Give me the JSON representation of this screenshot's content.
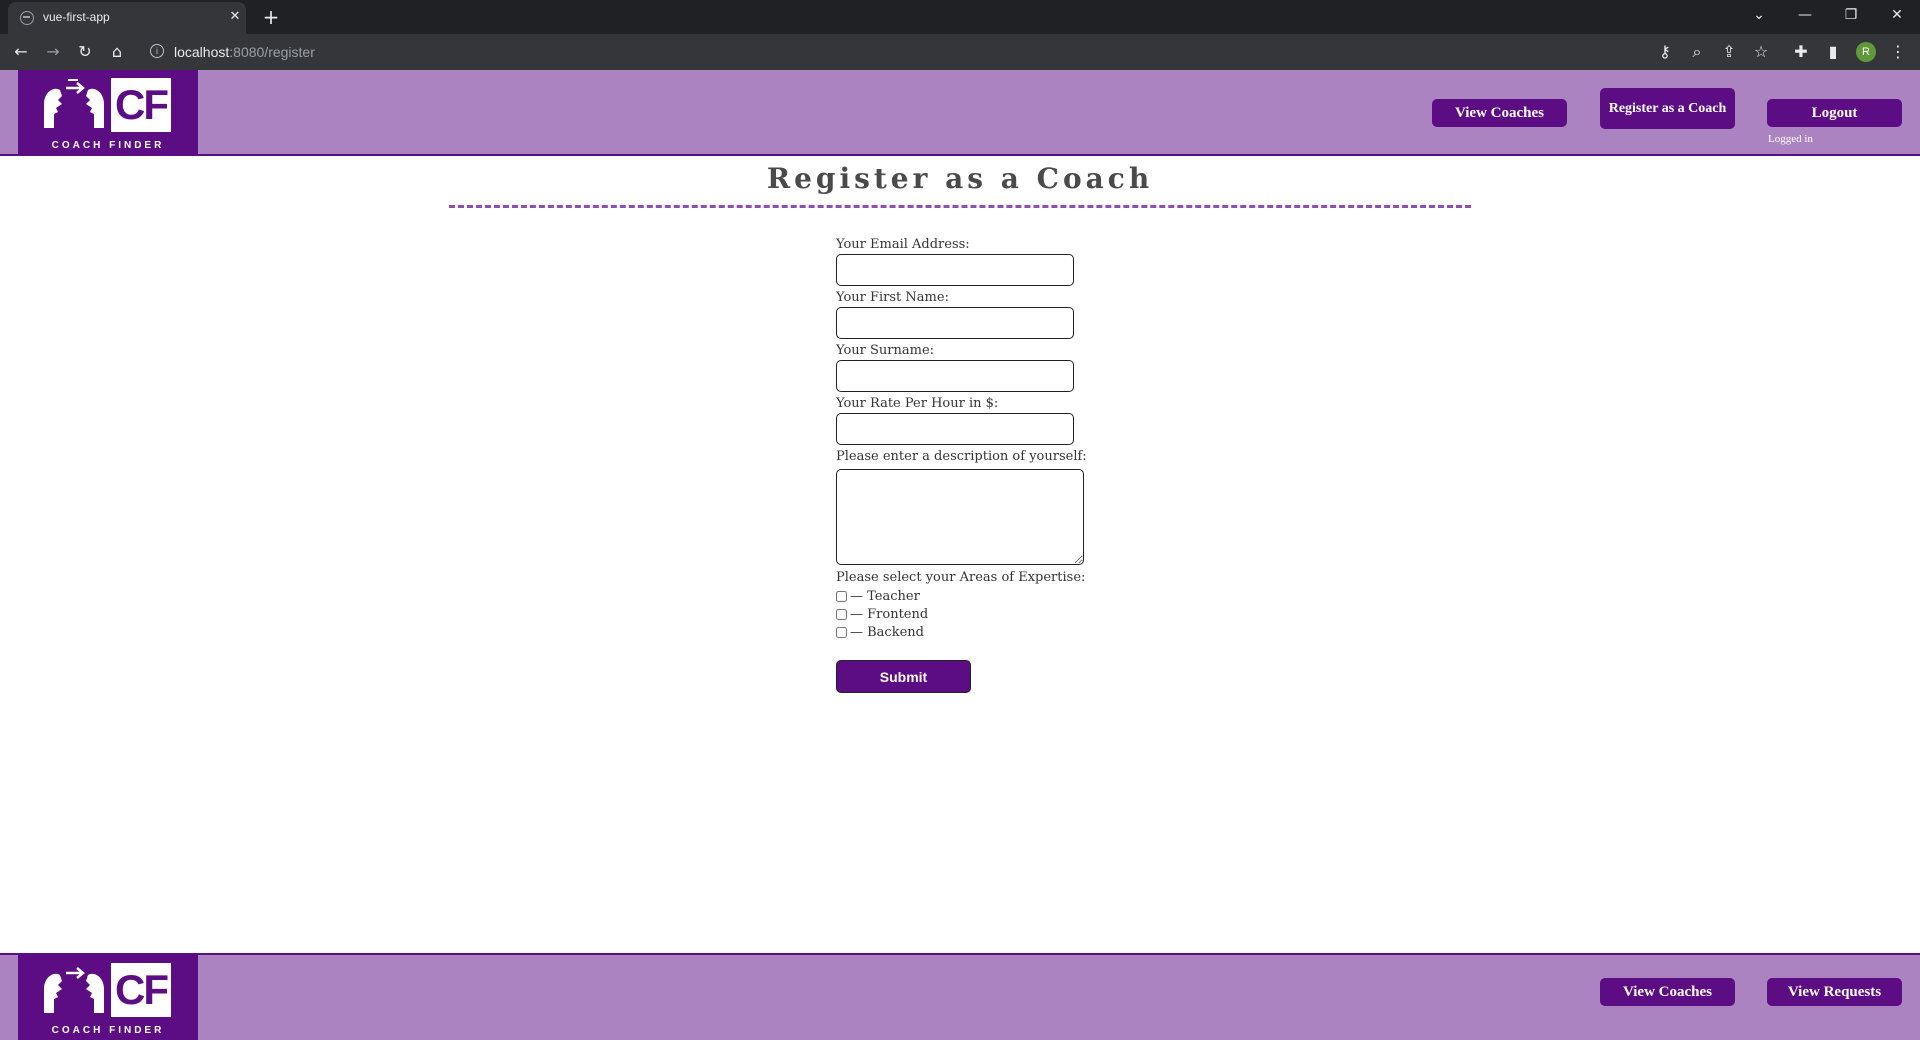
{
  "browser": {
    "tab_title": "vue-first-app",
    "tab_close": "✕",
    "new_tab": "+",
    "url_host": "localhost",
    "url_rest": ":8080/register",
    "avatar_initial": "R",
    "controls": {
      "tabs_menu": "⌄",
      "minimize": "—",
      "restore": "❐",
      "close": "✕"
    }
  },
  "logo": {
    "mark": "CF",
    "name": "COACH FINDER"
  },
  "header": {
    "view_coaches": "View Coaches",
    "register_coach": "Register as a Coach",
    "logout": "Logout",
    "status": "Logged in"
  },
  "page": {
    "title": "Register as a Coach"
  },
  "form": {
    "email_label": "Your Email Address:",
    "first_name_label": "Your First Name:",
    "surname_label": "Your Surname:",
    "rate_label": "Your Rate Per Hour in $:",
    "description_label": "Please enter a description of yourself:",
    "expertise_label": "Please select your Areas of Expertise:",
    "areas": [
      {
        "label": "— Teacher",
        "checked": false
      },
      {
        "label": "— Frontend",
        "checked": false
      },
      {
        "label": "— Backend",
        "checked": false
      }
    ],
    "submit": "Submit"
  },
  "footer": {
    "view_coaches": "View Coaches",
    "view_requests": "View Requests"
  },
  "colors": {
    "brand": "#5c0d83",
    "header_bg": "#ab83c1",
    "title_rule": "#8e4fb4"
  }
}
